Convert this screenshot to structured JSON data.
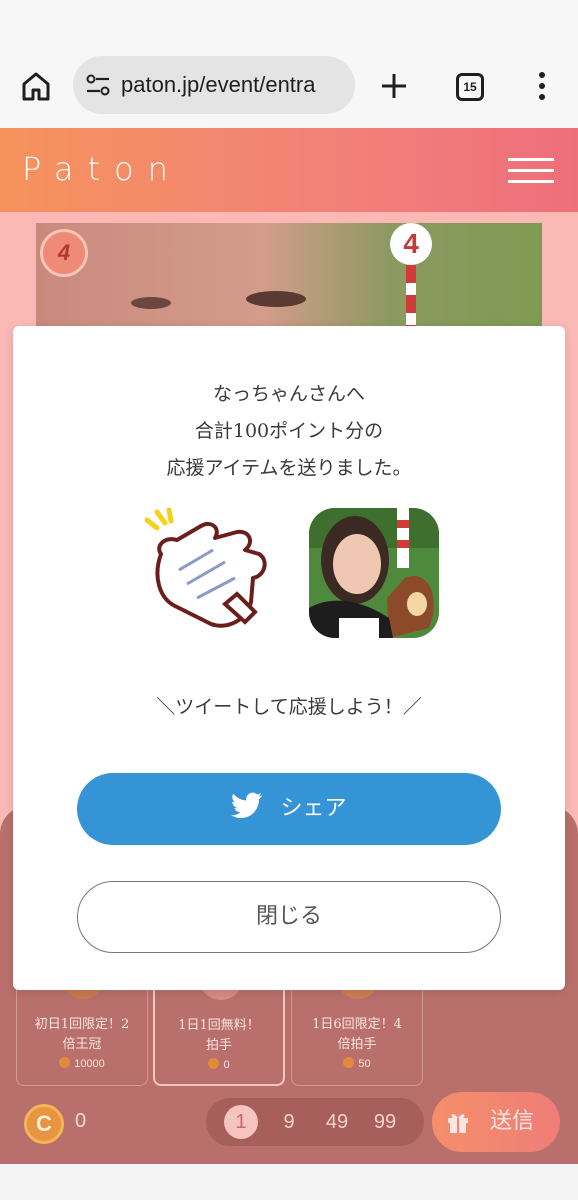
{
  "browser": {
    "url": "paton.jp/event/entra",
    "tab_count": "15"
  },
  "site": {
    "logo": "Paton"
  },
  "hero": {
    "rank": "4",
    "post_number": "4"
  },
  "modal": {
    "message_line1": "なっちゃんさんへ",
    "message_line2": "合計100ポイント分の",
    "message_line3": "応援アイテムを送りました。",
    "cta": "＼ツイートして応援しよう！／",
    "share_label": "シェア",
    "close_label": "閉じる"
  },
  "gifts": [
    {
      "caption_line1": "初日1回限定！2",
      "caption_line2": "倍王冠",
      "price": "10000"
    },
    {
      "caption_line1": "1日1回無料！",
      "caption_line2": "拍手",
      "price": "0"
    },
    {
      "caption_line1": "1日6回限定！4",
      "caption_line2": "倍拍手",
      "price": "50"
    }
  ],
  "footer": {
    "coin_symbol": "C",
    "coin_balance": "0",
    "quantities": [
      "1",
      "9",
      "49",
      "99"
    ],
    "selected_quantity": "1",
    "send_label": "送信"
  },
  "colors": {
    "header_gradient_start": "#f6935c",
    "header_gradient_end": "#ee6f7a",
    "share_button": "#3494d6",
    "page_background": "#fbb9b6"
  }
}
